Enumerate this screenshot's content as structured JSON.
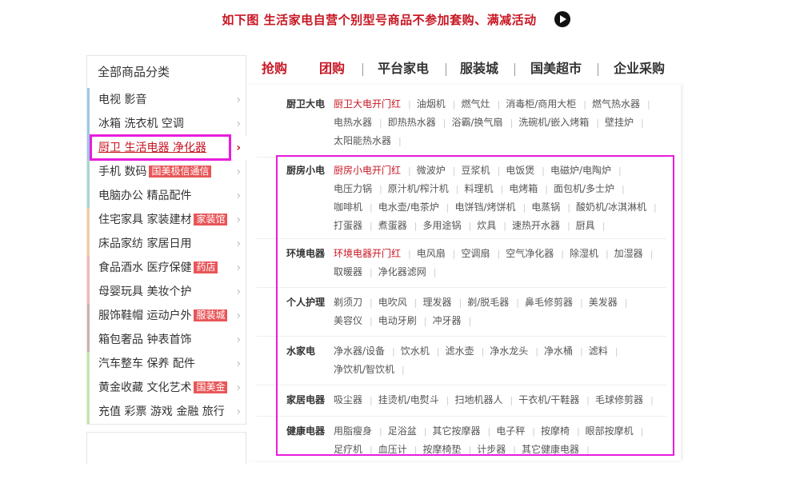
{
  "notice": {
    "text": "如下图  生活家电自营个别型号商品不参加套购、满减活动"
  },
  "sidebar": {
    "title": "全部商品分类",
    "categories": [
      {
        "label": "电视 影音",
        "tag": "",
        "color": "#9fc7e8"
      },
      {
        "label": "冰箱 洗衣机 空调",
        "tag": "",
        "color": "#9fc7e8"
      },
      {
        "label": "厨卫 生活电器 净化器",
        "tag": "",
        "color": "#9fc7e8"
      },
      {
        "label": "手机 数码",
        "tag": "国美极信通信",
        "color": "#a6d6cf"
      },
      {
        "label": "电脑办公 精品配件",
        "tag": "",
        "color": "#a6d6cf"
      },
      {
        "label": "住宅家具 家装建材",
        "tag": "家装馆",
        "color": "#f2cda0"
      },
      {
        "label": "床品家纺 家居日用",
        "tag": "",
        "color": "#f2cda0"
      },
      {
        "label": "食品酒水 医疗保健",
        "tag": "药店",
        "color": "#f3b6b6"
      },
      {
        "label": "母婴玩具 美妆个护",
        "tag": "",
        "color": "#f3b6b6"
      },
      {
        "label": "服饰鞋帽 运动户外",
        "tag": "服装城",
        "color": "#cbb2b2"
      },
      {
        "label": "箱包奢品 钟表首饰",
        "tag": "",
        "color": "#cbb2b2"
      },
      {
        "label": "汽车整车 保养 配件",
        "tag": "",
        "color": "#c6e6a8"
      },
      {
        "label": "黄金收藏 文化艺术",
        "tag": "国美金",
        "color": "#c6e6a8"
      },
      {
        "label": "充值 彩票 游戏 金融 旅行",
        "tag": "",
        "color": "#c6e6a8"
      }
    ]
  },
  "nav": {
    "items": [
      {
        "label": "抢购",
        "hot": true
      },
      {
        "label": "团购",
        "hot": true
      },
      {
        "label": "平台家电",
        "hot": false
      },
      {
        "label": "服装城",
        "hot": false
      },
      {
        "label": "国美超市",
        "hot": false
      },
      {
        "label": "企业采购",
        "hot": false
      }
    ]
  },
  "flyout": {
    "groups": [
      {
        "title": "厨卫大电",
        "red": "厨卫大电开门红",
        "items": [
          "油烟机",
          "燃气灶",
          "消毒柜/商用大柜",
          "燃气热水器",
          "电热水器",
          "即热热水器",
          "浴霸/换气扇",
          "洗碗机/嵌入烤箱",
          "壁挂炉",
          "太阳能热水器"
        ]
      },
      {
        "title": "厨房小电",
        "red": "厨房小电开门红",
        "items": [
          "微波炉",
          "豆浆机",
          "电饭煲",
          "电磁炉/电陶炉",
          "电压力锅",
          "原汁机/榨汁机",
          "料理机",
          "电烤箱",
          "面包机/多士炉",
          "咖啡机",
          "电水壶/电茶炉",
          "电饼铛/烤饼机",
          "电蒸锅",
          "酸奶机/冰淇淋机",
          "打蛋器",
          "煮蛋器",
          "多用途锅",
          "炊具",
          "速热开水器",
          "厨具"
        ]
      },
      {
        "title": "环境电器",
        "red": "环境电器开门红",
        "items": [
          "电风扇",
          "空调扇",
          "空气净化器",
          "除湿机",
          "加湿器",
          "取暖器",
          "净化器滤网"
        ]
      },
      {
        "title": "个人护理",
        "red": "",
        "items": [
          "剃须刀",
          "电吹风",
          "理发器",
          "剃/脱毛器",
          "鼻毛修剪器",
          "美发器",
          "美容仪",
          "电动牙刷",
          "冲牙器"
        ]
      },
      {
        "title": "水家电",
        "red": "",
        "items": [
          "净水器/设备",
          "饮水机",
          "滤水壶",
          "净水龙头",
          "净水桶",
          "滤料",
          "净饮机/智饮机"
        ]
      },
      {
        "title": "家居电器",
        "red": "",
        "items": [
          "吸尘器",
          "挂烫机/电熨斗",
          "扫地机器人",
          "干衣机/干鞋器",
          "毛球修剪器"
        ]
      },
      {
        "title": "健康电器",
        "red": "",
        "items": [
          "用脂瘦身",
          "足浴盆",
          "其它按摩器",
          "电子秤",
          "按摩椅",
          "眼部按摩机",
          "足疗机",
          "血压计",
          "按摩椅垫",
          "计步器",
          "其它健康电器"
        ]
      }
    ]
  }
}
